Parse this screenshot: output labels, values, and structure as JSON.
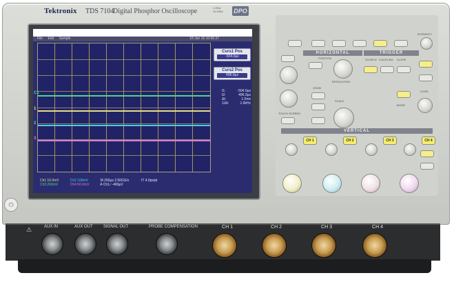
{
  "instrument": {
    "brand": "Tektronix",
    "model": "TDS 7104",
    "subtitle": "Digital Phosphor Oscilloscope",
    "badge": "DPO",
    "spec_lines": [
      "1 GHz",
      "10 GS/s"
    ]
  },
  "screen": {
    "menu": [
      "File",
      "Edit",
      "Sample"
    ],
    "timestamp": "18 Jun 16 16:56:37",
    "markers": [
      "C1",
      "1",
      "2",
      "3"
    ],
    "readouts": [
      {
        "title": "Curs1 Pos",
        "value": "-504.0µs"
      },
      {
        "title": "Curs2 Pos",
        "value": "496.0µs"
      }
    ],
    "cursor_list": [
      {
        "label": "t1:",
        "value": "-504.0µs"
      },
      {
        "label": "t2:",
        "value": "496.0µs"
      },
      {
        "label": "Δt:",
        "value": "1.0ms"
      },
      {
        "label": "1/Δt:",
        "value": "1.0kHz"
      }
    ],
    "bottom": {
      "ch1": "Ch1",
      "ch1_scale": "10.0mV",
      "ch2": "Ch2",
      "ch2_scale": "100mV",
      "ch3": "Ch3",
      "ch3_scale": "200mV",
      "ch4": "Ch4",
      "ch4_scale": "50.0mV",
      "timebase": "M 200µs 2.50GS/s",
      "trigger": "A Ch1 ∕ -460µV",
      "record": "IT 4.0ps/pt"
    },
    "trace_colors": [
      "#48d98d",
      "#e8e08a",
      "#46d0e0",
      "#d67ad8"
    ]
  },
  "controls": {
    "sections": {
      "horizontal": "HORIZONTAL",
      "trigger": "TRIGGER",
      "vertical": "VERTICAL"
    },
    "labels": {
      "intensity": "INTENSITY",
      "position": "POSITION",
      "resolution": "RESOLUTION",
      "scale": "SCALE",
      "zoom": "ZOOM",
      "touch_screen": "TOUCH SCREEN",
      "source": "SOURCE",
      "coupling": "COUPLING",
      "slope": "SLOPE",
      "mode": "MODE",
      "level": "LEVEL"
    },
    "channel_buttons": [
      "CH 1",
      "CH 2",
      "CH 3",
      "CH 4"
    ],
    "channel_colors": [
      "#f6ee6e",
      "#f6ee6e",
      "#f6ee6e",
      "#f6ee6e"
    ]
  },
  "front_io": {
    "aux_in": "AUX IN",
    "aux_out": "AUX OUT",
    "signal_out": "SIGNAL OUT",
    "probe_comp": "PROBE COMPENSATION",
    "channels": [
      "CH 1",
      "CH 2",
      "CH 3",
      "CH 4"
    ]
  }
}
